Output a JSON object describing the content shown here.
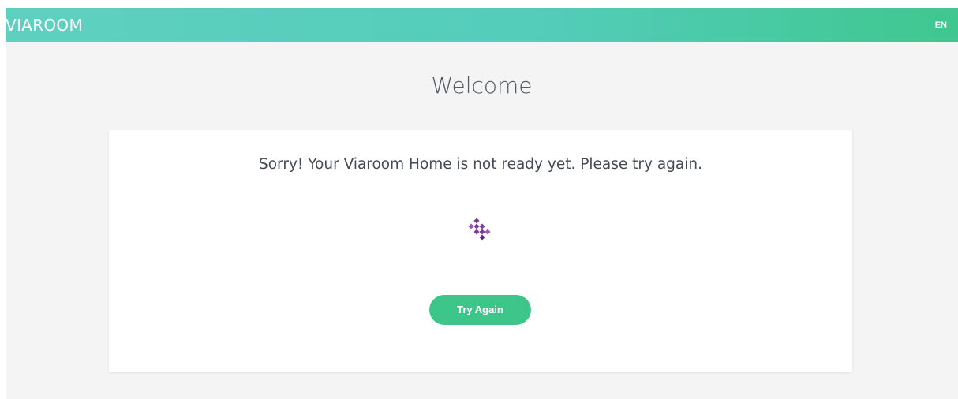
{
  "header": {
    "brand": "VIAROOM",
    "language": "EN"
  },
  "page": {
    "title": "Welcome"
  },
  "status": {
    "message": "Sorry! Your Viaroom Home is not ready yet. Please try again.",
    "loader_icon": "diamond-grid-loader-icon",
    "try_again_label": "Try Again"
  },
  "colors": {
    "header_gradient_start": "#5fd0c0",
    "header_gradient_end": "#3fc78f",
    "button": "#3ec68a",
    "loader": "#7b3b96",
    "background": "#f4f4f4",
    "card": "#ffffff"
  }
}
